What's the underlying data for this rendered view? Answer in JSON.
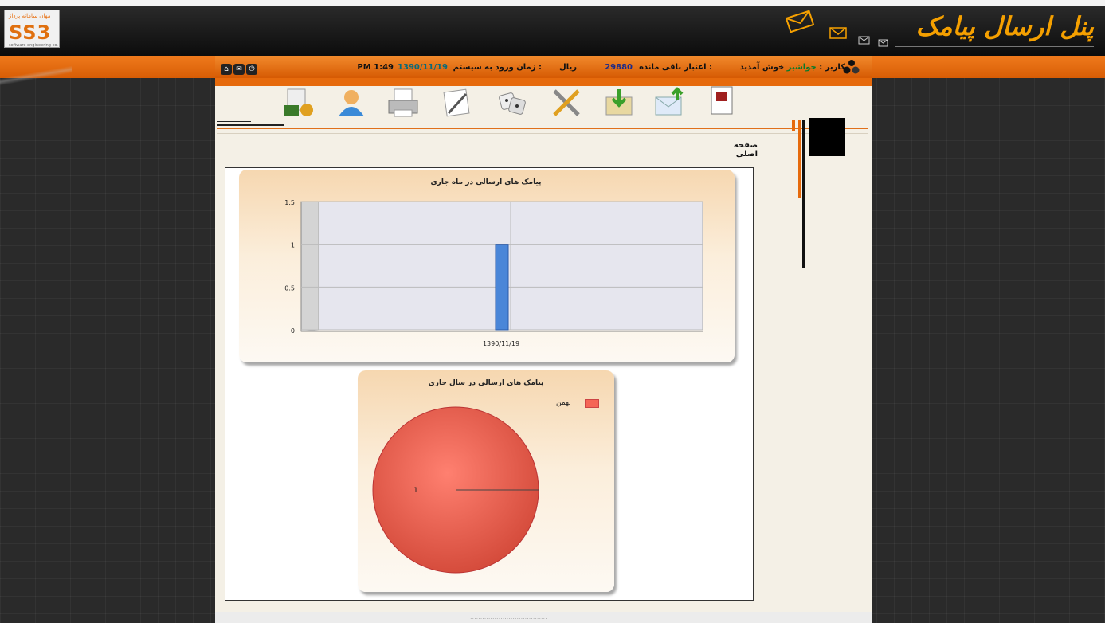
{
  "header": {
    "brand": "پنل ارسال پیامک",
    "logo_subtitle": "مهان سامانه پرداز",
    "logo_mark": "SS3",
    "logo_line": "software engineering co."
  },
  "infobar": {
    "user_label": "کاربر :",
    "user_name": "جواشیر",
    "welcome": "خوش آمدید",
    "credit_label": "اعتبار باقی مانده :",
    "credit_value": "29880",
    "currency": "ریال",
    "login_label": "زمان ورود به سیستم :",
    "login_date": "1390/11/19",
    "login_time": "PM 1:49"
  },
  "toolbar": {
    "icons": [
      "report-money-icon",
      "user-icon",
      "printer-icon",
      "compose-icon",
      "dice-icon",
      "tools-icon",
      "inbox-icon",
      "send-mail-icon",
      "phonebook-icon"
    ]
  },
  "breadcrumb": "صفحه اصلی",
  "charts": {
    "bar": {
      "title": "پیامک های ارسالی در ماه جاری"
    },
    "pie": {
      "title": "پیامک های ارسالی در سال جاری",
      "legend": "بهمن",
      "slice_label": "1"
    }
  },
  "chart_data": [
    {
      "type": "bar",
      "title": "پیامک های ارسالی در ماه جاری",
      "categories": [
        "1390/11/19"
      ],
      "values": [
        1
      ],
      "ylim": [
        0,
        1.5
      ],
      "yticks": [
        "0",
        "0.5",
        "1",
        "1.5"
      ],
      "color": "#4a86d8",
      "grid": true
    },
    {
      "type": "pie",
      "title": "پیامک های ارسالی در سال جاری",
      "categories": [
        "بهمن"
      ],
      "values": [
        1
      ],
      "color": "#f56555",
      "legend": "top-right"
    }
  ],
  "footer": "......................................"
}
